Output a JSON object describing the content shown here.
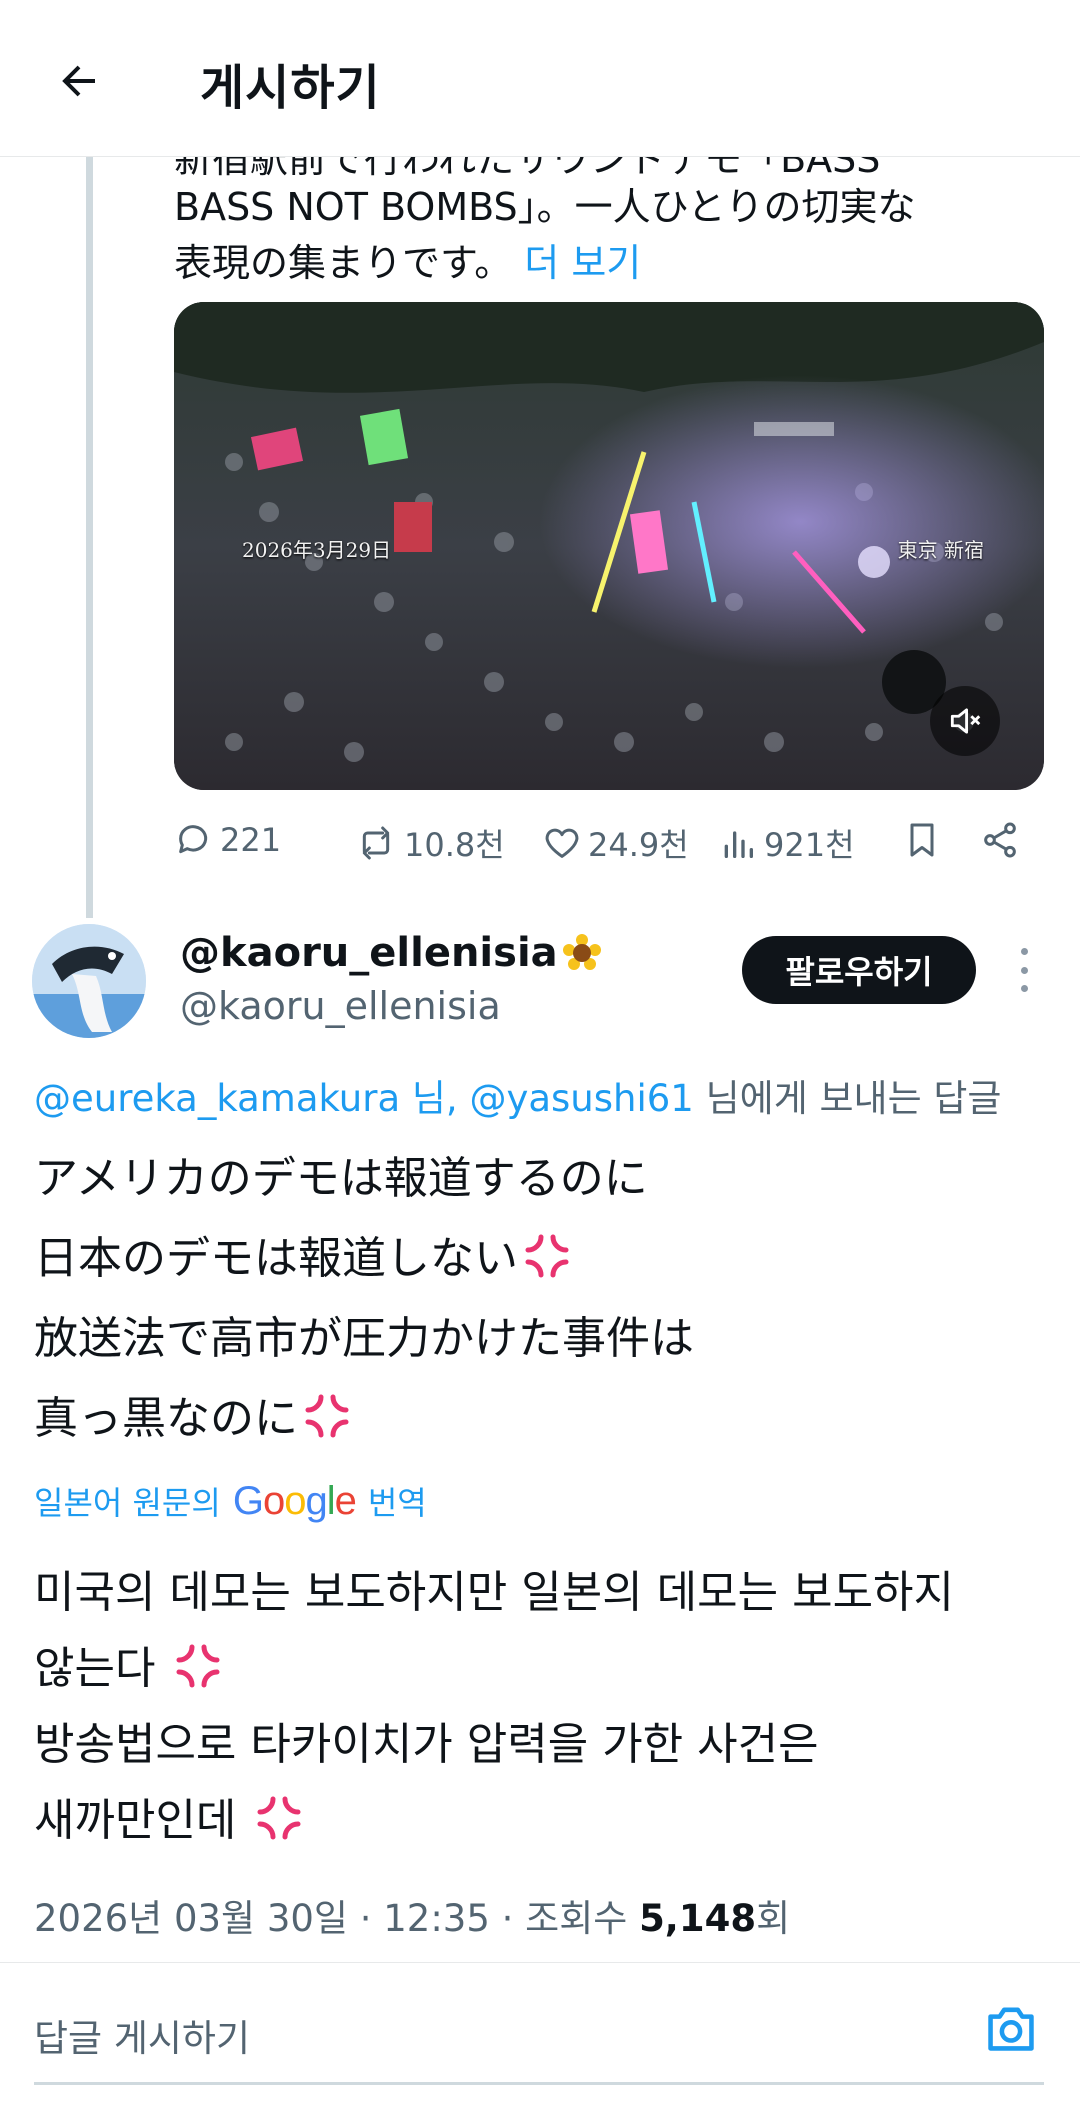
{
  "header": {
    "title": "게시하기",
    "back_icon": "arrow-left-icon"
  },
  "previous_post": {
    "clipped_text": "新宿駅前で行われたサウンドデモ「BASS",
    "text_line_1": "BASS NOT BOMBS」。一人ひとりの切実な",
    "text_line_2": "表現の集まりです。",
    "more_label": "더 보기",
    "video": {
      "date_caption": "2026年3月29日",
      "place_caption": "東京 新宿",
      "mute_icon": "speaker-mute-icon"
    },
    "stats": {
      "replies": "221",
      "reposts": "10.8천",
      "likes": "24.9천",
      "views": "921천"
    }
  },
  "reply": {
    "display_name": "@kaoru_ellenisia",
    "handle": "@kaoru_ellenisia",
    "follow_label": "팔로우하기",
    "replying_to_mention_1": "@eureka_kamakura 님,",
    "replying_to_mention_2": "@yasushi61",
    "replying_to_suffix": "님에게 보내는 답글",
    "original_lines": [
      "アメリカのデモは報道するのに",
      "日本のデモは報道しない",
      "放送法で高市が圧力かけた事件は",
      "真っ黒なのに"
    ],
    "translate_prefix": "일본어 원문의",
    "translate_brand": "Google",
    "translate_suffix": "번역",
    "translated_lines": [
      "미국의 데모는 보도하지만 일본의 데모는 보도하지",
      "않는다",
      "방송법으로 타카이치가 압력을 가한 사건은",
      "새까만인데"
    ],
    "timestamp": "2026년 03월 30일 · 12:35 · 조회수",
    "view_count": "5,148",
    "view_suffix": "회"
  },
  "composer": {
    "placeholder": "답글 게시하기",
    "camera_icon": "camera-icon"
  },
  "colors": {
    "accent": "#1d9bf0",
    "text": "#0f1419",
    "muted": "#536471",
    "anger": "#e8336f"
  }
}
